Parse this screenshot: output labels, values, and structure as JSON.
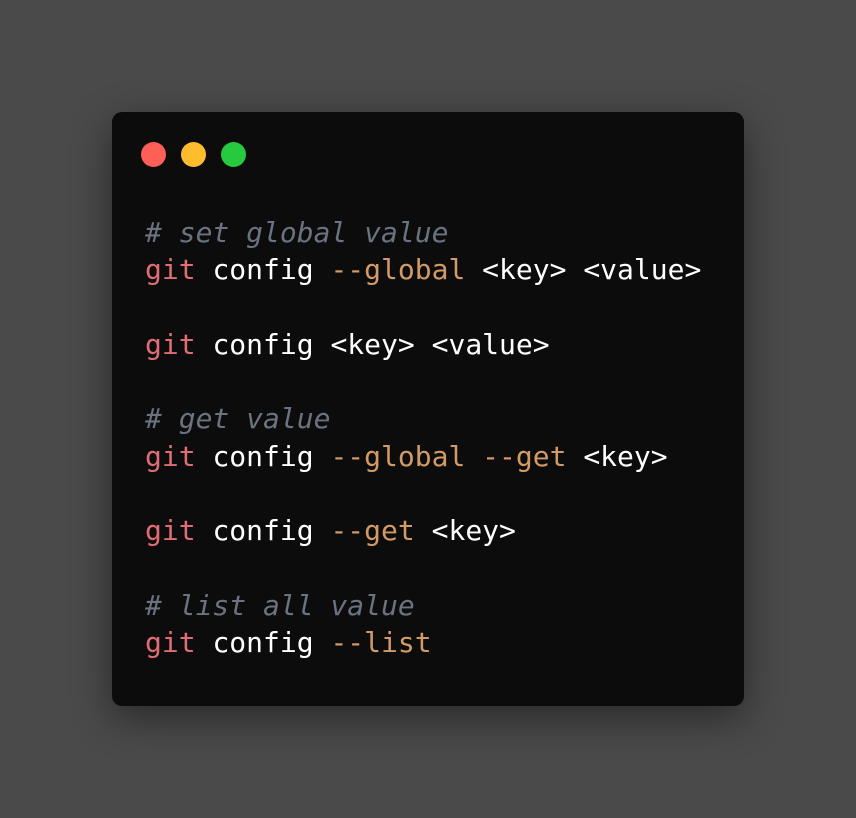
{
  "colors": {
    "page_background": "#4a4a4a",
    "window_background": "#0c0c0c",
    "close_light": "#ff5f56",
    "minimize_light": "#ffbd2e",
    "maximize_light": "#27c93f",
    "comment": "#6b7280",
    "command": "#e06c75",
    "text": "#ffffff",
    "flag": "#d19a66"
  },
  "window_controls": [
    "close",
    "minimize",
    "maximize"
  ],
  "code": {
    "line1_comment": "# set global value",
    "line2_cmd": "git",
    "line2_sub": "config",
    "line2_flag": "--global",
    "line2_args": "<key> <value>",
    "line4_cmd": "git",
    "line4_sub": "config",
    "line4_args": "<key> <value>",
    "line6_comment": "# get value",
    "line7_cmd": "git",
    "line7_sub": "config",
    "line7_flag1": "--global",
    "line7_flag2": "--get",
    "line7_args": "<key>",
    "line9_cmd": "git",
    "line9_sub": "config",
    "line9_flag": "--get",
    "line9_args": "<key>",
    "line11_comment": "# list all value",
    "line12_cmd": "git",
    "line12_sub": "config",
    "line12_flag": "--list"
  }
}
